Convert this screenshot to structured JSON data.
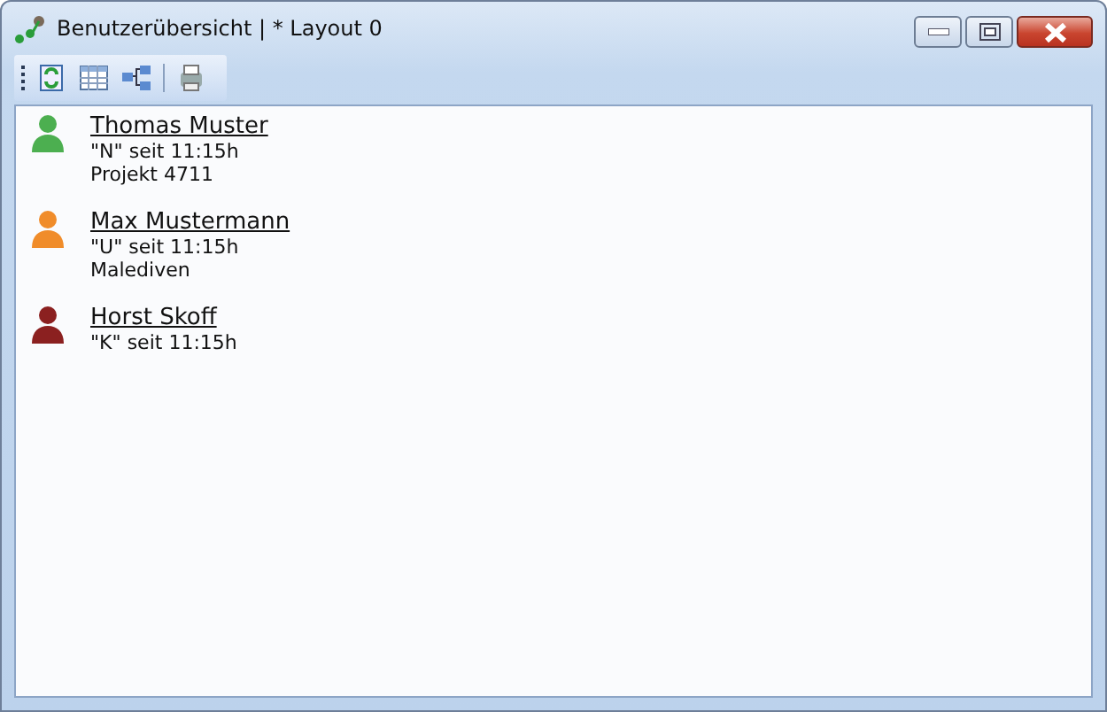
{
  "window": {
    "title": "Benutzerübersicht | * Layout 0"
  },
  "users": [
    {
      "name": "Thomas Muster",
      "status": "\"N\" seit 11:15h",
      "note": "Projekt 4711",
      "color": "#4caf50"
    },
    {
      "name": "Max Mustermann",
      "status": "\"U\" seit 11:15h",
      "note": "Malediven",
      "color": "#f08c2a"
    },
    {
      "name": "Horst Skoff",
      "status": "\"K\" seit 11:15h",
      "color": "#8b2020"
    }
  ]
}
